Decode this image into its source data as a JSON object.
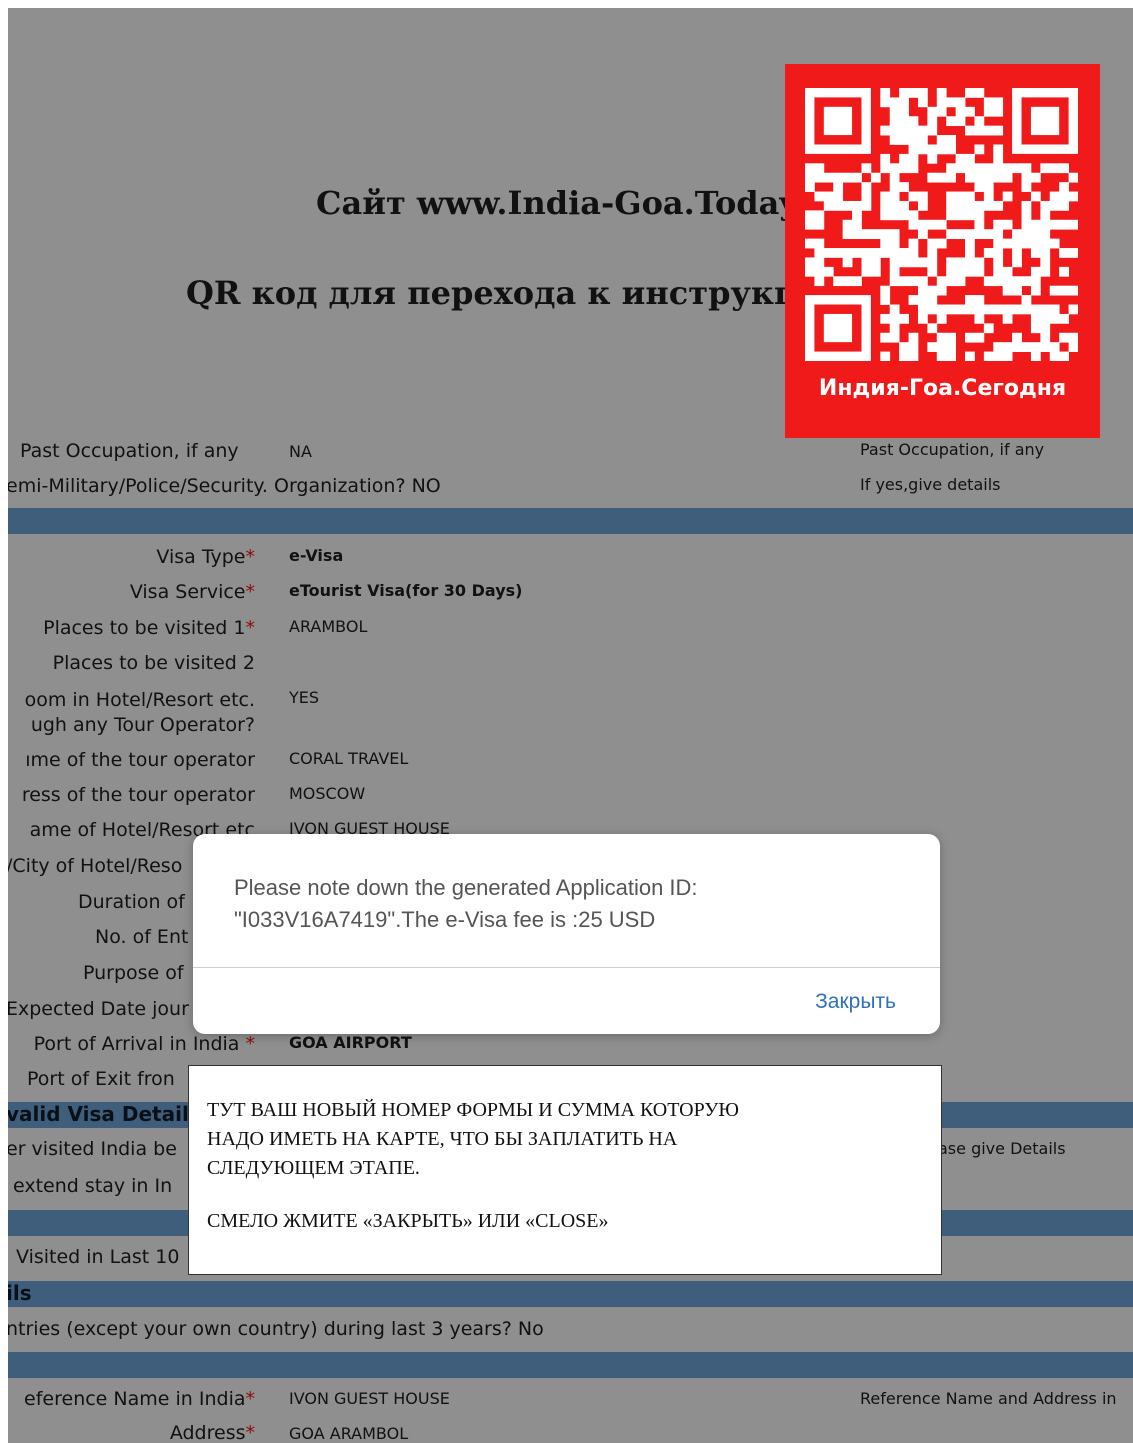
{
  "promo": {
    "site_line": "Сайт www.India-Goa.Today",
    "qr_line": "QR код для перехода к инструкции",
    "qr_caption": "Индия-Гоа.Сегодня",
    "qr_color": "#f01a1a"
  },
  "occupation": {
    "past_label": "Past Occupation, if any",
    "past_value": "NA",
    "org_question": "emi-Military/Police/Security. Organization? NO",
    "right_label": "Past Occupation, if any",
    "right_details": "If yes,give details"
  },
  "visa": {
    "rows": [
      {
        "label": "Visa Type",
        "required": "*",
        "value": "e-Visa",
        "bold": true
      },
      {
        "label": "Visa Service",
        "required": "*",
        "value": "eTourist Visa(for 30 Days)",
        "bold": true
      },
      {
        "label": "Places to be visited 1",
        "required": "*",
        "value": "ARAMBOL",
        "bold": false
      },
      {
        "label": "Places to be visited 2",
        "required": "",
        "value": "",
        "bold": false
      }
    ],
    "hotel_q_line1": "oom in Hotel/Resort etc.",
    "hotel_q_line2": "ugh any Tour Operator?",
    "hotel_q_value": "YES",
    "tour_name_label": "ıme of the tour operator",
    "tour_name_value": "CORAL TRAVEL",
    "tour_addr_label": "ress of the tour operator",
    "tour_addr_value": "MOSCOW",
    "hotel_name_label": "ame of Hotel/Resort etc",
    "hotel_name_value": "IVON GUEST HOUSE",
    "city_label": "/City of Hotel/Reso",
    "duration_label": "Duration of",
    "entries_label": "No. of Ent",
    "purpose_label": "Purpose of",
    "date_label": "Expected Date jour",
    "arrival_label": "Port of Arrival in India",
    "arrival_required": "*",
    "arrival_value": "GOA AIRPORT",
    "exit_label": "Port of Exit fron"
  },
  "previous": {
    "section_title": "valid Visa Details",
    "visited_label": "er visited India be",
    "extend_label": "extend stay in In",
    "right_details": "ase give Details",
    "visited_last_label": "Visited in Last 10"
  },
  "other": {
    "section_title": "ils",
    "countries_question": "ntries (except your own country) during last 3 years? No"
  },
  "reference": {
    "name_label": "eference Name in India",
    "name_required": "*",
    "name_value": "IVON GUEST HOUSE",
    "right_label": "Reference Name and Address in",
    "address_label": "Address",
    "address_required": "*",
    "address_value": "GOA ARAMBOL"
  },
  "dialog": {
    "message_line1": "Please note down the generated Application ID:",
    "message_line2": "\"I033V16A7419\".The e-Visa fee is :25 USD",
    "close_label": "Закрыть"
  },
  "note": {
    "line1": "ТУТ ВАШ НОВЫЙ НОМЕР ФОРМЫ И СУММА КОТОРУЮ",
    "line2": "НАДО ИМЕТЬ НА КАРТЕ, ЧТО БЫ ЗАПЛАТИТЬ НА",
    "line3": "СЛЕДУЮЩЕМ ЭТАПЕ.",
    "action": "СМЕЛО ЖМИТЕ «ЗАКРЫТЬ» ИЛИ «CLOSE»"
  }
}
